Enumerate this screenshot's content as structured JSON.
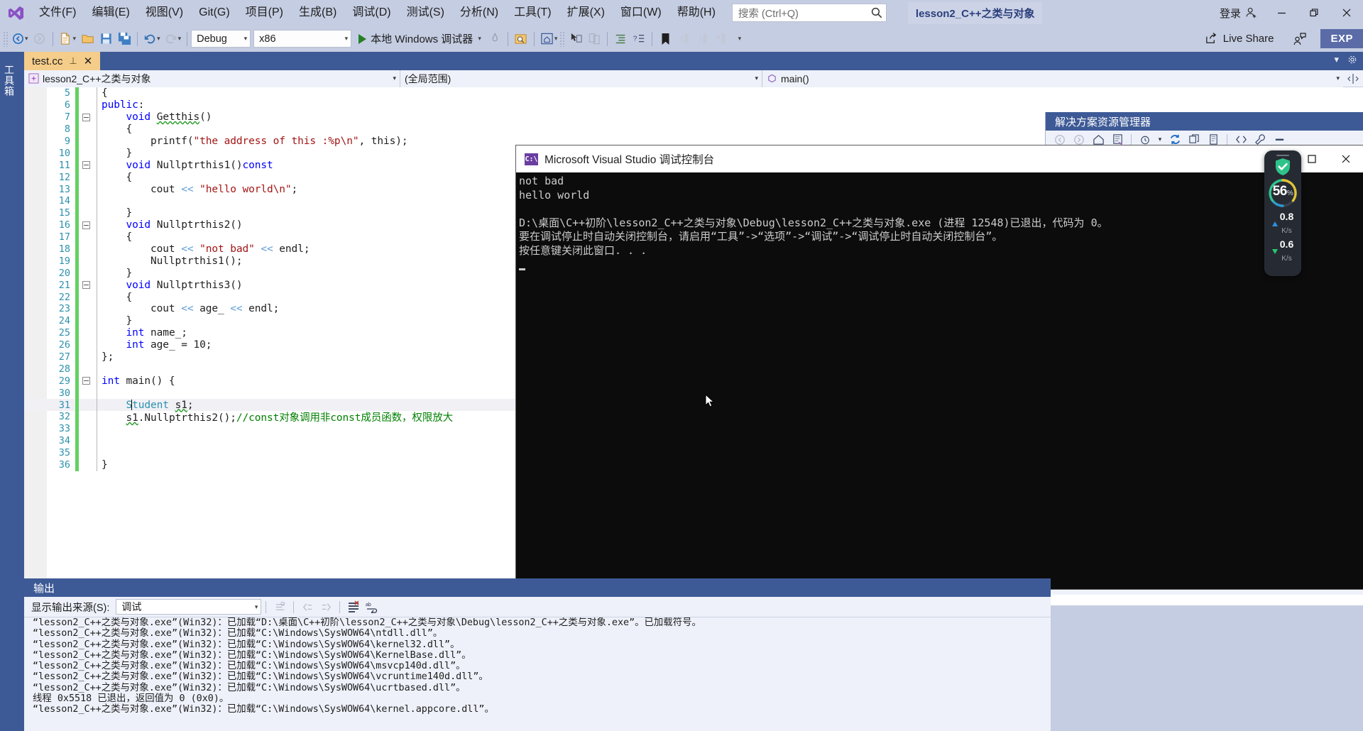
{
  "menubar": {
    "items": [
      "文件(F)",
      "编辑(E)",
      "视图(V)",
      "Git(G)",
      "项目(P)",
      "生成(B)",
      "调试(D)",
      "测试(S)",
      "分析(N)",
      "工具(T)",
      "扩展(X)",
      "窗口(W)",
      "帮助(H)"
    ],
    "search_placeholder": "搜索 (Ctrl+Q)",
    "project_chip": "lesson2_C++之类与对象",
    "signin_label": "登录",
    "minimize": "—",
    "restore": "❐",
    "close": "✕"
  },
  "toolbar": {
    "config_combo": "Debug",
    "platform_combo": "x86",
    "run_label": "本地 Windows 调试器",
    "live_share_label": "Live Share",
    "exp_badge": "EXP"
  },
  "toolbox": {
    "vertical_label": "工具箱"
  },
  "editor": {
    "tab_name": "test.cc",
    "tab_pin": "⊥",
    "tab_close": "✕",
    "nav_project": "lesson2_C++之类与对象",
    "nav_scope": "(全局范围)",
    "nav_member": "main()",
    "lines": [
      {
        "n": 5,
        "fold": "",
        "text": "{"
      },
      {
        "n": 6,
        "fold": "",
        "text": "public:"
      },
      {
        "n": 7,
        "fold": "minus",
        "text": "    void Getthis()"
      },
      {
        "n": 8,
        "fold": "",
        "text": "    {"
      },
      {
        "n": 9,
        "fold": "",
        "text": "        printf(\"the address of this :%p\\n\", this);"
      },
      {
        "n": 10,
        "fold": "",
        "text": "    }"
      },
      {
        "n": 11,
        "fold": "minus",
        "text": "    void Nullptrthis1()const"
      },
      {
        "n": 12,
        "fold": "",
        "text": "    {"
      },
      {
        "n": 13,
        "fold": "",
        "text": "        cout << \"hello world\\n\";"
      },
      {
        "n": 14,
        "fold": "",
        "text": ""
      },
      {
        "n": 15,
        "fold": "",
        "text": "    }"
      },
      {
        "n": 16,
        "fold": "minus",
        "text": "    void Nullptrthis2()"
      },
      {
        "n": 17,
        "fold": "",
        "text": "    {"
      },
      {
        "n": 18,
        "fold": "",
        "text": "        cout << \"not bad\" << endl;"
      },
      {
        "n": 19,
        "fold": "",
        "text": "        Nullptrthis1();"
      },
      {
        "n": 20,
        "fold": "",
        "text": "    }"
      },
      {
        "n": 21,
        "fold": "minus",
        "text": "    void Nullptrthis3()"
      },
      {
        "n": 22,
        "fold": "",
        "text": "    {"
      },
      {
        "n": 23,
        "fold": "",
        "text": "        cout << age_ << endl;"
      },
      {
        "n": 24,
        "fold": "",
        "text": "    }"
      },
      {
        "n": 25,
        "fold": "",
        "text": "    int name_;"
      },
      {
        "n": 26,
        "fold": "",
        "text": "    int age_ = 10;"
      },
      {
        "n": 27,
        "fold": "",
        "text": "};"
      },
      {
        "n": 28,
        "fold": "",
        "text": ""
      },
      {
        "n": 29,
        "fold": "minus",
        "text": "int main() {"
      },
      {
        "n": 30,
        "fold": "",
        "text": ""
      },
      {
        "n": 31,
        "fold": "",
        "text": "    Student s1;"
      },
      {
        "n": 32,
        "fold": "",
        "text": "    s1.Nullptrthis2();//const对象调用非const成员函数，权限放大"
      },
      {
        "n": 33,
        "fold": "",
        "text": ""
      },
      {
        "n": 34,
        "fold": "",
        "text": ""
      },
      {
        "n": 35,
        "fold": "",
        "text": ""
      },
      {
        "n": 36,
        "fold": "",
        "text": "}"
      }
    ]
  },
  "console": {
    "title": "Microsoft Visual Studio 调试控制台",
    "maximize": "☐",
    "close": "✕",
    "output_lines": [
      "not bad",
      "hello world",
      "",
      "D:\\桌面\\C++初阶\\lesson2_C++之类与对象\\Debug\\lesson2_C++之类与对象.exe (进程 12548)已退出，代码为 0。",
      "要在调试停止时自动关闭控制台，请启用“工具”->“选项”->“调试”->“调试停止时自动关闭控制台”。",
      "按任意键关闭此窗口. . ."
    ]
  },
  "solution_explorer": {
    "title": "解决方案资源管理器"
  },
  "network_widget": {
    "percent": "56",
    "percent_unit": "%",
    "upload_value": "0.8",
    "upload_unit": "K/s",
    "download_value": "0.6",
    "download_unit": "K/s",
    "accent": "#28c76f",
    "upload_color": "#2d8fe0"
  },
  "output_panel": {
    "title": "输出",
    "source_label": "显示输出来源(S):",
    "source_value": "调试",
    "lines": [
      "“lesson2_C++之类与对象.exe”(Win32)：已加载“D:\\桌面\\C++初阶\\lesson2_C++之类与对象\\Debug\\lesson2_C++之类与对象.exe”。已加载符号。",
      "“lesson2_C++之类与对象.exe”(Win32)：已加载“C:\\Windows\\SysWOW64\\ntdll.dll”。",
      "“lesson2_C++之类与对象.exe”(Win32)：已加载“C:\\Windows\\SysWOW64\\kernel32.dll”。",
      "“lesson2_C++之类与对象.exe”(Win32)：已加载“C:\\Windows\\SysWOW64\\KernelBase.dll”。",
      "“lesson2_C++之类与对象.exe”(Win32)：已加载“C:\\Windows\\SysWOW64\\msvcp140d.dll”。",
      "“lesson2_C++之类与对象.exe”(Win32)：已加载“C:\\Windows\\SysWOW64\\vcruntime140d.dll”。",
      "“lesson2_C++之类与对象.exe”(Win32)：已加载“C:\\Windows\\SysWOW64\\ucrtbased.dll”。",
      "线程 0x5518 已退出，返回值为 0 (0x0)。",
      "“lesson2_C++之类与对象.exe”(Win32)：已加载“C:\\Windows\\SysWOW64\\kernel.appcore.dll”。"
    ]
  }
}
